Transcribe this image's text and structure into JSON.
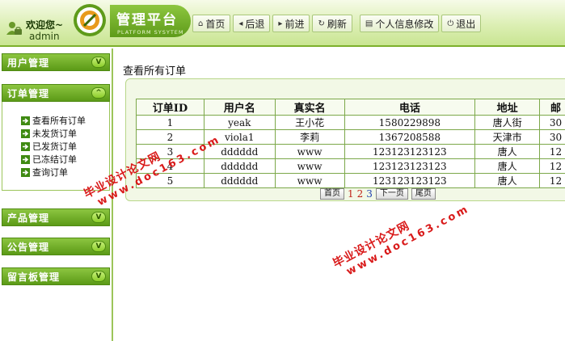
{
  "header": {
    "welcome": "欢迎您~",
    "username": "admin",
    "logo_title": "管理平台",
    "logo_subtitle": "PLATFORM SYSYTEM",
    "nav": {
      "home": "首页",
      "back": "后退",
      "forward": "前进",
      "refresh": "刷新",
      "profile": "个人信息修改",
      "logout": "退出"
    }
  },
  "sidebar": {
    "user_mgmt": "用户管理",
    "order_mgmt": "订单管理",
    "order_items": [
      "查看所有订单",
      "未发货订单",
      "已发货订单",
      "已冻结订单",
      "查询订单"
    ],
    "product_mgmt": "产品管理",
    "notice_mgmt": "公告管理",
    "guestbook_mgmt": "留言板管理",
    "toggle_collapsed": "V",
    "toggle_expanded": "^"
  },
  "main": {
    "title": "查看所有订单",
    "columns": [
      "订单ID",
      "用户名",
      "真实名",
      "电话",
      "地址",
      "邮"
    ],
    "rows": [
      [
        "1",
        "yeak",
        "王小花",
        "1580229898",
        "唐人街",
        "30"
      ],
      [
        "2",
        "viola1",
        "李莉",
        "1367208588",
        "天津市",
        "30"
      ],
      [
        "3",
        "dddddd",
        "www",
        "123123123123",
        "唐人",
        "12"
      ],
      [
        "4",
        "dddddd",
        "www",
        "123123123123",
        "唐人",
        "12"
      ],
      [
        "5",
        "dddddd",
        "www",
        "123123123123",
        "唐人",
        "12"
      ]
    ],
    "pager": {
      "first": "首页",
      "pages": [
        "1",
        "2",
        "3"
      ],
      "next": "下一页",
      "last": "尾页"
    }
  },
  "watermark": {
    "line1": "毕业设计论文网",
    "line2": "www.doc163.com"
  }
}
